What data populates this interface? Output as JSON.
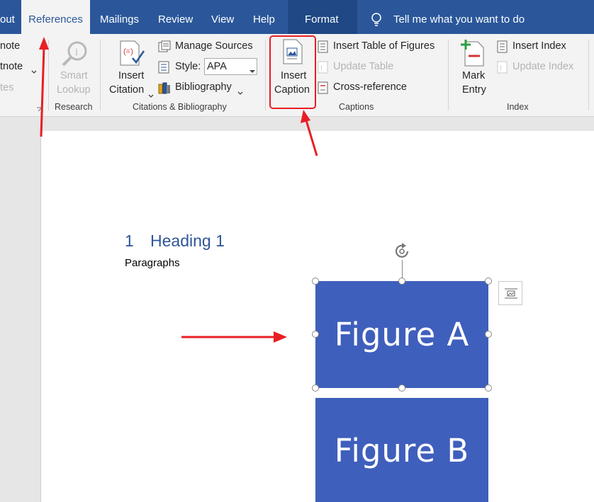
{
  "tabs": [
    {
      "label": "out"
    },
    {
      "label": "References"
    },
    {
      "label": "Mailings"
    },
    {
      "label": "Review"
    },
    {
      "label": "View"
    },
    {
      "label": "Help"
    },
    {
      "label": "Format"
    }
  ],
  "tell_me": "Tell me what you want to do",
  "ribbon": {
    "footnotes": {
      "item1": "note",
      "item2": "tnote",
      "item3": "tes"
    },
    "research": {
      "smart_lookup_1": "Smart",
      "smart_lookup_2": "Lookup",
      "group": "Research"
    },
    "citations": {
      "insert_citation_1": "Insert",
      "insert_citation_2": "Citation",
      "manage_sources": "Manage Sources",
      "style_label": "Style:",
      "style_value": "APA",
      "bibliography": "Bibliography",
      "group": "Citations & Bibliography"
    },
    "captions": {
      "insert_caption_1": "Insert",
      "insert_caption_2": "Caption",
      "insert_table_of_figures": "Insert Table of Figures",
      "update_table": "Update Table",
      "cross_reference": "Cross-reference",
      "group": "Captions"
    },
    "index": {
      "mark_entry_1": "Mark",
      "mark_entry_2": "Entry",
      "insert_index": "Insert Index",
      "update_index": "Update Index",
      "group": "Index"
    }
  },
  "document": {
    "heading_number": "1",
    "heading_text": "Heading 1",
    "paragraph": "Paragraphs",
    "figure_a": "Figure A",
    "figure_b": "Figure B"
  },
  "colors": {
    "ribbon_blue": "#2b579a",
    "figure_blue": "#3f5fbc",
    "annotation_red": "#e81e25"
  }
}
